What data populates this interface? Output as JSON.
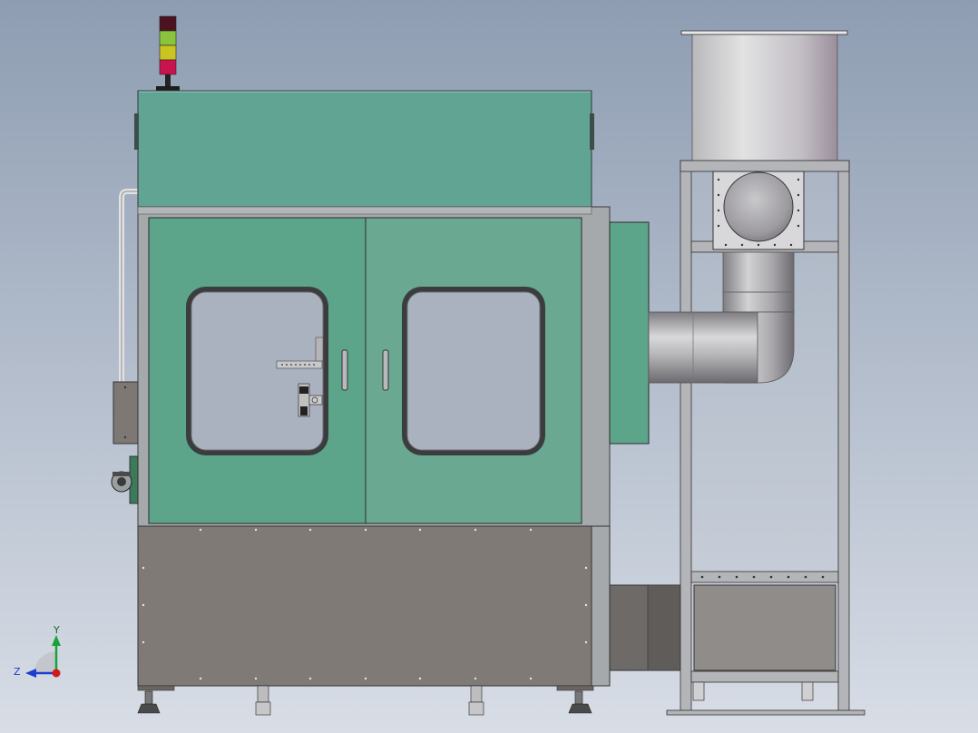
{
  "viewport": {
    "background_top": "#8e9db2",
    "background_bottom": "#d8dde6"
  },
  "colors": {
    "cabinet_green": "#62a494",
    "door_green_left": "#5da58a",
    "door_green_right": "#6aa892",
    "frame_grey": "#a5a9ab",
    "base_grey": "#7f7a76",
    "steel_light": "#d6d7d9",
    "steel_dark": "#8b8a8d",
    "glass": "#a9b2be",
    "seal_dark": "#3a3c3e",
    "light_red": "#c8134f",
    "light_yellow": "#c9c41f",
    "light_green": "#8ac43c",
    "light_cap": "#4b1320"
  },
  "triad": {
    "y_label": "Y",
    "z_label": "Z",
    "y_color": "#1aa23a",
    "z_color": "#1a3fd0",
    "x_color": "#d01a1a"
  },
  "icons": {
    "tower_light": "signal-tower-icon",
    "orientation": "axis-triad-icon"
  }
}
